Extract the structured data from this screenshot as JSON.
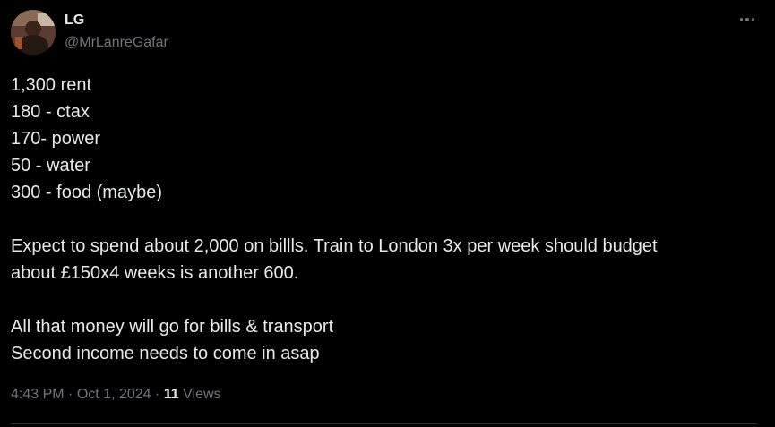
{
  "author": {
    "display_name": "LG",
    "handle": "@MrLanreGafar"
  },
  "more_icon": "more-horizontal-icon",
  "tweet": {
    "paragraphs": [
      [
        "1,300 rent",
        "180 - ctax",
        "170- power",
        "50 - water",
        "300 - food (maybe)"
      ],
      [
        "Expect to spend about 2,000 on billls. Train to London 3x per week should budget",
        "about £150x4 weeks is another 600."
      ],
      [
        "All that money will go for bills & transport",
        "Second income needs to come in asap"
      ]
    ]
  },
  "meta": {
    "time": "4:43 PM",
    "separator": "·",
    "date": "Oct 1, 2024",
    "views_count": "11",
    "views_label": "Views"
  },
  "colors": {
    "background": "#000000",
    "text_primary": "#e7e9ea",
    "text_secondary": "#71767b",
    "divider": "#2f3336"
  }
}
